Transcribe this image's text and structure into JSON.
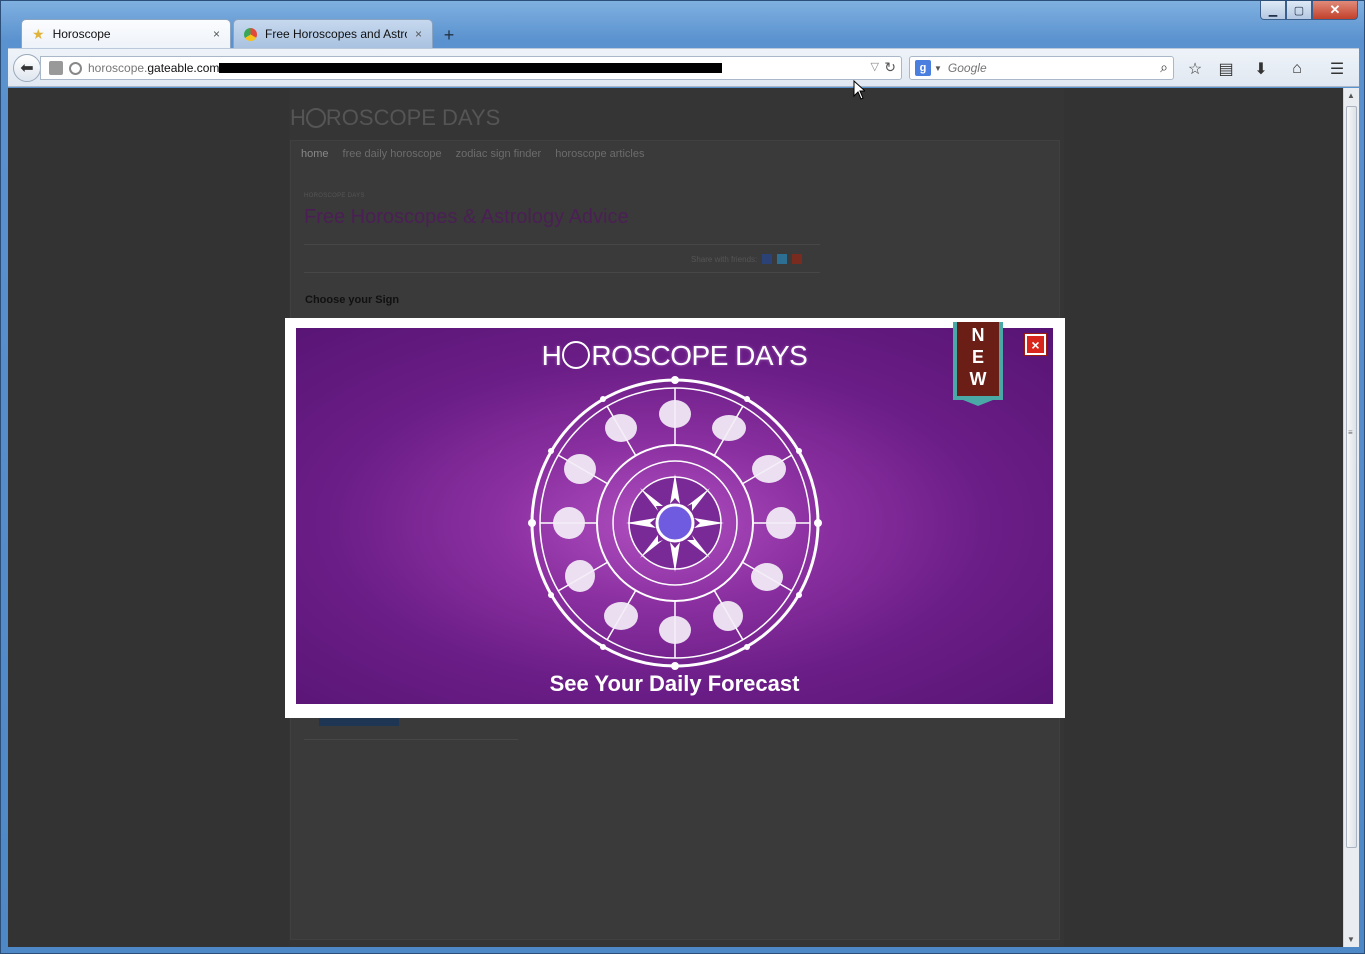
{
  "browser": {
    "tabs": [
      {
        "title": "Horoscope",
        "close": "×"
      },
      {
        "title": "Free Horoscopes and Astro...",
        "close": "×"
      }
    ],
    "new_tab": "+",
    "url_prefix": "horoscope.",
    "url_domain": "gateable.com",
    "search_placeholder": "Google",
    "search_engine_letter": "g",
    "window_buttons": {
      "minimize": "▁",
      "maximize": "▢",
      "close": "✕"
    }
  },
  "page": {
    "logo": "ROSCOPE DAYS",
    "logo_prefix": "H",
    "menu": [
      "home",
      "free daily horoscope",
      "zodiac sign finder",
      "horoscope articles"
    ],
    "breadcrumb": "HOROSCOPE DAYS",
    "title": "Free Horoscopes & Astrology Advice",
    "share_label": "Share with friends:",
    "choose_sign": "Choose your Sign"
  },
  "modal": {
    "brand_prefix": "H",
    "brand_rest": "ROSCOPE DAYS",
    "ribbon_letters": [
      "N",
      "E",
      "W"
    ],
    "forecast": "See Your Daily Forecast",
    "close": "×"
  },
  "colors": {
    "content_bg": "#333333",
    "banner_purple": "#6a1d86",
    "ribbon_brown": "#6a1e16",
    "ribbon_teal": "#4aa8a6",
    "close_red": "#d8261d"
  }
}
